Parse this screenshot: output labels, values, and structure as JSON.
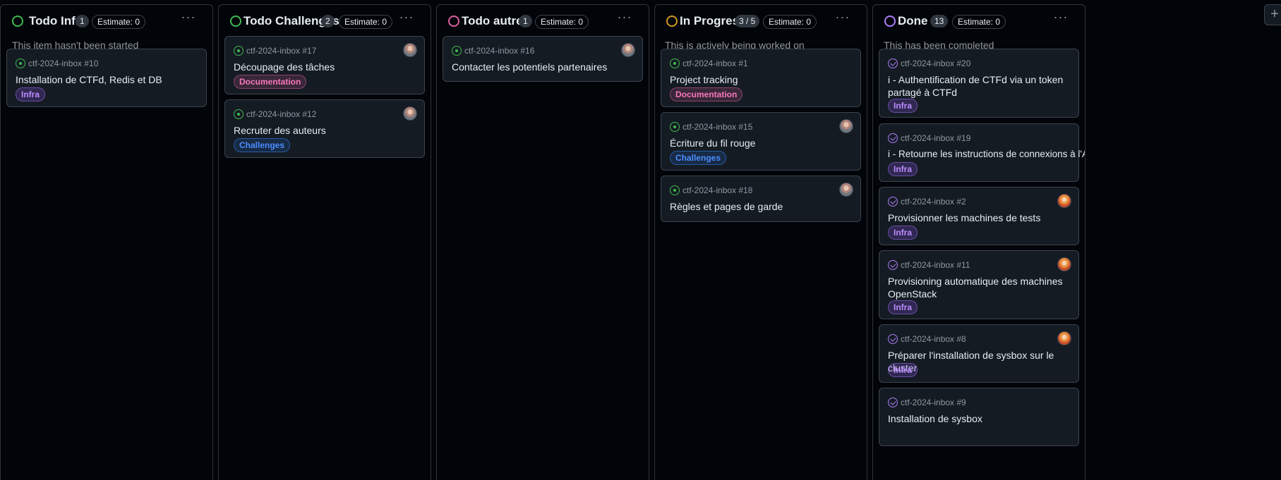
{
  "columns": [
    {
      "title": "Todo Infra",
      "count": "1",
      "estimate": "Estimate: 0",
      "status_color": "#3fb950",
      "description": "This item hasn't been started",
      "cards": [
        {
          "ref": "ctf-2024-inbox #10",
          "title": "Installation de CTFd, Redis et DB",
          "label": "Infra",
          "label_kind": "infra",
          "icon": "open-issue-icon"
        }
      ]
    },
    {
      "title": "Todo Challenges",
      "count": "2",
      "estimate": "Estimate: 0",
      "status_color": "#3fb950",
      "description": "",
      "cards": [
        {
          "ref": "ctf-2024-inbox #17",
          "title": "Découpage des tâches",
          "label": "Documentation",
          "label_kind": "doc",
          "icon": "open-issue-icon",
          "avatar": "avatar-gray"
        },
        {
          "ref": "ctf-2024-inbox #12",
          "title": "Recruter des auteurs",
          "label": "Challenges",
          "label_kind": "chal",
          "icon": "open-issue-icon",
          "avatar": "avatar-gray"
        }
      ]
    },
    {
      "title": "Todo autres",
      "count": "1",
      "estimate": "Estimate: 0",
      "status_color": "#db61a2",
      "description": "",
      "cards": [
        {
          "ref": "ctf-2024-inbox #16",
          "title": "Contacter les potentiels partenaires",
          "icon": "open-issue-icon",
          "avatar": "avatar-gray"
        }
      ]
    },
    {
      "title": "In Progress",
      "count": "3 / 5",
      "estimate": "Estimate: 0",
      "status_color": "#d29922",
      "description": "This is actively being worked on",
      "cards": [
        {
          "ref": "ctf-2024-inbox #1",
          "title": "Project tracking",
          "label": "Documentation",
          "label_kind": "doc",
          "icon": "open-issue-icon"
        },
        {
          "ref": "ctf-2024-inbox #15",
          "title": "Écriture du fil rouge",
          "label": "Challenges",
          "label_kind": "chal",
          "icon": "open-issue-icon",
          "avatar": "avatar-gray"
        },
        {
          "ref": "ctf-2024-inbox #18",
          "title": "Règles et pages de garde",
          "icon": "open-issue-icon",
          "avatar": "avatar-gray"
        }
      ]
    },
    {
      "title": "Done",
      "count": "13",
      "estimate": "Estimate: 0",
      "status_color": "#ab7df8",
      "description": "This has been completed",
      "cards": [
        {
          "ref": "ctf-2024-inbox #20",
          "title": "i - Authentification de CTFd via un token partagé à CTFd",
          "label": "Infra",
          "label_kind": "infra",
          "icon": "closed-issue-icon"
        },
        {
          "ref": "ctf-2024-inbox #19",
          "title": "i - Retourne les instructions de connexions à l'API",
          "label": "Infra",
          "label_kind": "infra",
          "icon": "closed-issue-icon"
        },
        {
          "ref": "ctf-2024-inbox #2",
          "title": "Provisionner les machines de tests",
          "label": "Infra",
          "label_kind": "infra",
          "icon": "closed-issue-icon",
          "avatar": "avatar-orange"
        },
        {
          "ref": "ctf-2024-inbox #11",
          "title": "Provisioning automatique des machines OpenStack",
          "label": "Infra",
          "label_kind": "infra",
          "icon": "closed-issue-icon",
          "avatar": "avatar-orange"
        },
        {
          "ref": "ctf-2024-inbox #8",
          "title": "Préparer l'installation de sysbox sur le cluster",
          "label": "Infra",
          "label_kind": "infra",
          "icon": "closed-issue-icon",
          "avatar": "avatar-orange"
        },
        {
          "ref": "ctf-2024-inbox #9",
          "title": "Installation de sysbox",
          "icon": "closed-issue-icon"
        }
      ]
    }
  ],
  "add_column_icon": "+"
}
